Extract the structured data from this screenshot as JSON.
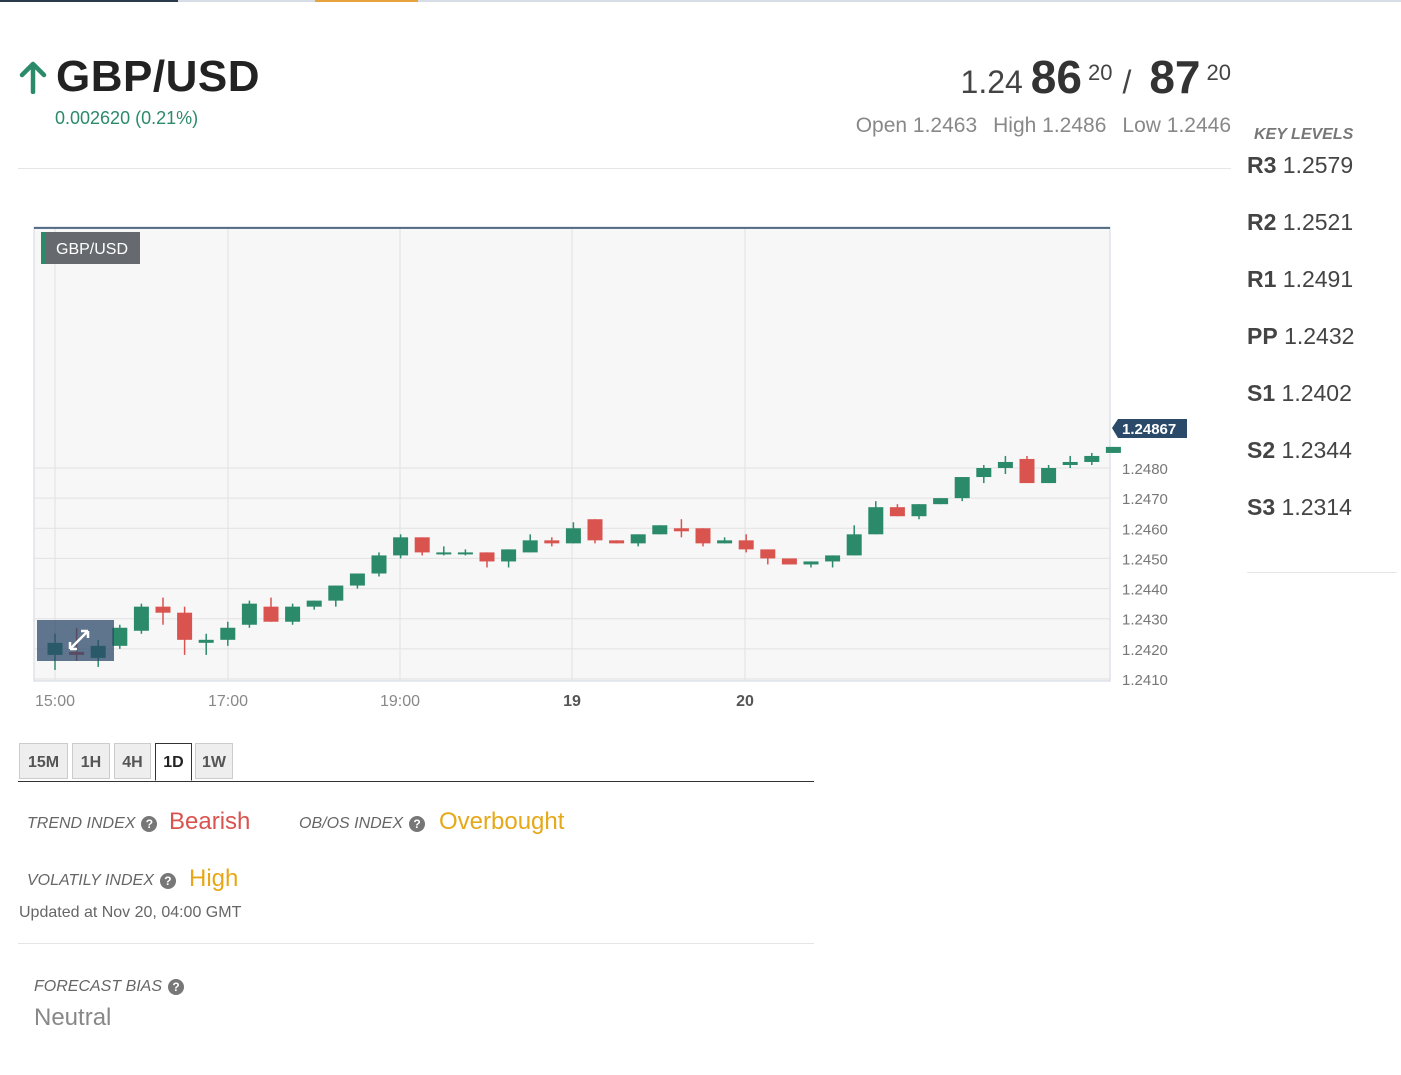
{
  "header": {
    "pair": "GBP/USD",
    "change": "0.002620 (0.21%)",
    "bid_prefix": "1.24",
    "bid_big": "86",
    "bid_sup": "20",
    "slash": "/",
    "ask_big": "87",
    "ask_sup": "20",
    "open": "Open 1.2463",
    "high": "High 1.2486",
    "low": "Low 1.2446"
  },
  "key_levels": {
    "title": "KEY LEVELS",
    "items": [
      {
        "name": "R3",
        "value": "1.2579"
      },
      {
        "name": "R2",
        "value": "1.2521"
      },
      {
        "name": "R1",
        "value": "1.2491"
      },
      {
        "name": "PP",
        "value": "1.2432"
      },
      {
        "name": "S1",
        "value": "1.2402"
      },
      {
        "name": "S2",
        "value": "1.2344"
      },
      {
        "name": "S3",
        "value": "1.2314"
      }
    ]
  },
  "timeframes": [
    "15M",
    "1H",
    "4H",
    "1D",
    "1W"
  ],
  "active_timeframe": "1D",
  "indices": {
    "trend_label": "TREND INDEX",
    "trend_value": "Bearish",
    "obos_label": "OB/OS INDEX",
    "obos_value": "Overbought",
    "volatility_label": "VOLATILY INDEX",
    "volatility_value": "High",
    "updated": "Updated at Nov 20, 04:00 GMT",
    "forecast_label": "FORECAST BIAS",
    "forecast_value": "Neutral"
  },
  "colors": {
    "up": "#2a8a6a",
    "down": "#d9534f",
    "accent": "#e6a818",
    "price_tag": "#2b4a6a"
  },
  "chart_data": {
    "type": "candlestick",
    "legend": "GBP/USD",
    "last_price_label": "1.24867",
    "ylim": [
      1.241,
      1.2487
    ],
    "y_ticks": [
      "1.2410",
      "1.2420",
      "1.2430",
      "1.2440",
      "1.2450",
      "1.2460",
      "1.2470",
      "1.2480"
    ],
    "x_tick_labels": [
      "15:00",
      "17:00",
      "19:00",
      "19",
      "20"
    ],
    "grid": true,
    "candles": [
      {
        "o": 1.2418,
        "h": 1.2425,
        "l": 1.2413,
        "c": 1.2422
      },
      {
        "o": 1.2419,
        "h": 1.2427,
        "l": 1.2416,
        "c": 1.2418
      },
      {
        "o": 1.2417,
        "h": 1.2423,
        "l": 1.2414,
        "c": 1.2421
      },
      {
        "o": 1.2421,
        "h": 1.2428,
        "l": 1.242,
        "c": 1.2427
      },
      {
        "o": 1.2426,
        "h": 1.2435,
        "l": 1.2425,
        "c": 1.2434
      },
      {
        "o": 1.2434,
        "h": 1.2437,
        "l": 1.2428,
        "c": 1.2432
      },
      {
        "o": 1.2432,
        "h": 1.2434,
        "l": 1.2418,
        "c": 1.2423
      },
      {
        "o": 1.2422,
        "h": 1.2425,
        "l": 1.2418,
        "c": 1.2423
      },
      {
        "o": 1.2423,
        "h": 1.2429,
        "l": 1.2421,
        "c": 1.2427
      },
      {
        "o": 1.2428,
        "h": 1.2436,
        "l": 1.2427,
        "c": 1.2435
      },
      {
        "o": 1.2434,
        "h": 1.2437,
        "l": 1.2429,
        "c": 1.2429
      },
      {
        "o": 1.2429,
        "h": 1.2435,
        "l": 1.2428,
        "c": 1.2434
      },
      {
        "o": 1.2434,
        "h": 1.2436,
        "l": 1.2433,
        "c": 1.2436
      },
      {
        "o": 1.2436,
        "h": 1.2441,
        "l": 1.2434,
        "c": 1.2441
      },
      {
        "o": 1.2441,
        "h": 1.2445,
        "l": 1.244,
        "c": 1.2445
      },
      {
        "o": 1.2445,
        "h": 1.2452,
        "l": 1.2444,
        "c": 1.2451
      },
      {
        "o": 1.2451,
        "h": 1.2458,
        "l": 1.245,
        "c": 1.2457
      },
      {
        "o": 1.2457,
        "h": 1.2457,
        "l": 1.2451,
        "c": 1.2452
      },
      {
        "o": 1.2452,
        "h": 1.2454,
        "l": 1.2451,
        "c": 1.2452
      },
      {
        "o": 1.2452,
        "h": 1.2453,
        "l": 1.2451,
        "c": 1.2452
      },
      {
        "o": 1.2452,
        "h": 1.2452,
        "l": 1.2447,
        "c": 1.2449
      },
      {
        "o": 1.2449,
        "h": 1.2453,
        "l": 1.2447,
        "c": 1.2453
      },
      {
        "o": 1.2452,
        "h": 1.2458,
        "l": 1.2452,
        "c": 1.2456
      },
      {
        "o": 1.2456,
        "h": 1.2457,
        "l": 1.2454,
        "c": 1.2455
      },
      {
        "o": 1.2455,
        "h": 1.2462,
        "l": 1.2455,
        "c": 1.246
      },
      {
        "o": 1.2463,
        "h": 1.2463,
        "l": 1.2455,
        "c": 1.2456
      },
      {
        "o": 1.2456,
        "h": 1.2456,
        "l": 1.2455,
        "c": 1.2455
      },
      {
        "o": 1.2455,
        "h": 1.2458,
        "l": 1.2454,
        "c": 1.2458
      },
      {
        "o": 1.2458,
        "h": 1.2461,
        "l": 1.2458,
        "c": 1.2461
      },
      {
        "o": 1.246,
        "h": 1.2463,
        "l": 1.2457,
        "c": 1.2459
      },
      {
        "o": 1.246,
        "h": 1.246,
        "l": 1.2454,
        "c": 1.2455
      },
      {
        "o": 1.2455,
        "h": 1.2457,
        "l": 1.2455,
        "c": 1.2456
      },
      {
        "o": 1.2456,
        "h": 1.2458,
        "l": 1.2452,
        "c": 1.2453
      },
      {
        "o": 1.2453,
        "h": 1.2453,
        "l": 1.2448,
        "c": 1.245
      },
      {
        "o": 1.245,
        "h": 1.245,
        "l": 1.2448,
        "c": 1.2448
      },
      {
        "o": 1.2448,
        "h": 1.2449,
        "l": 1.2447,
        "c": 1.2449
      },
      {
        "o": 1.2449,
        "h": 1.2451,
        "l": 1.2447,
        "c": 1.2451
      },
      {
        "o": 1.2451,
        "h": 1.2461,
        "l": 1.2451,
        "c": 1.2458
      },
      {
        "o": 1.2458,
        "h": 1.2469,
        "l": 1.2458,
        "c": 1.2467
      },
      {
        "o": 1.2467,
        "h": 1.2468,
        "l": 1.2464,
        "c": 1.2464
      },
      {
        "o": 1.2464,
        "h": 1.2468,
        "l": 1.2463,
        "c": 1.2468
      },
      {
        "o": 1.2468,
        "h": 1.247,
        "l": 1.2468,
        "c": 1.247
      },
      {
        "o": 1.247,
        "h": 1.2477,
        "l": 1.2469,
        "c": 1.2477
      },
      {
        "o": 1.2477,
        "h": 1.2481,
        "l": 1.2475,
        "c": 1.248
      },
      {
        "o": 1.248,
        "h": 1.2484,
        "l": 1.2478,
        "c": 1.2482
      },
      {
        "o": 1.2483,
        "h": 1.2484,
        "l": 1.2475,
        "c": 1.2475
      },
      {
        "o": 1.2475,
        "h": 1.2481,
        "l": 1.2475,
        "c": 1.248
      },
      {
        "o": 1.2481,
        "h": 1.2484,
        "l": 1.248,
        "c": 1.2482
      },
      {
        "o": 1.2482,
        "h": 1.2485,
        "l": 1.2481,
        "c": 1.2484
      },
      {
        "o": 1.2485,
        "h": 1.2487,
        "l": 1.2485,
        "c": 1.2487
      }
    ]
  }
}
